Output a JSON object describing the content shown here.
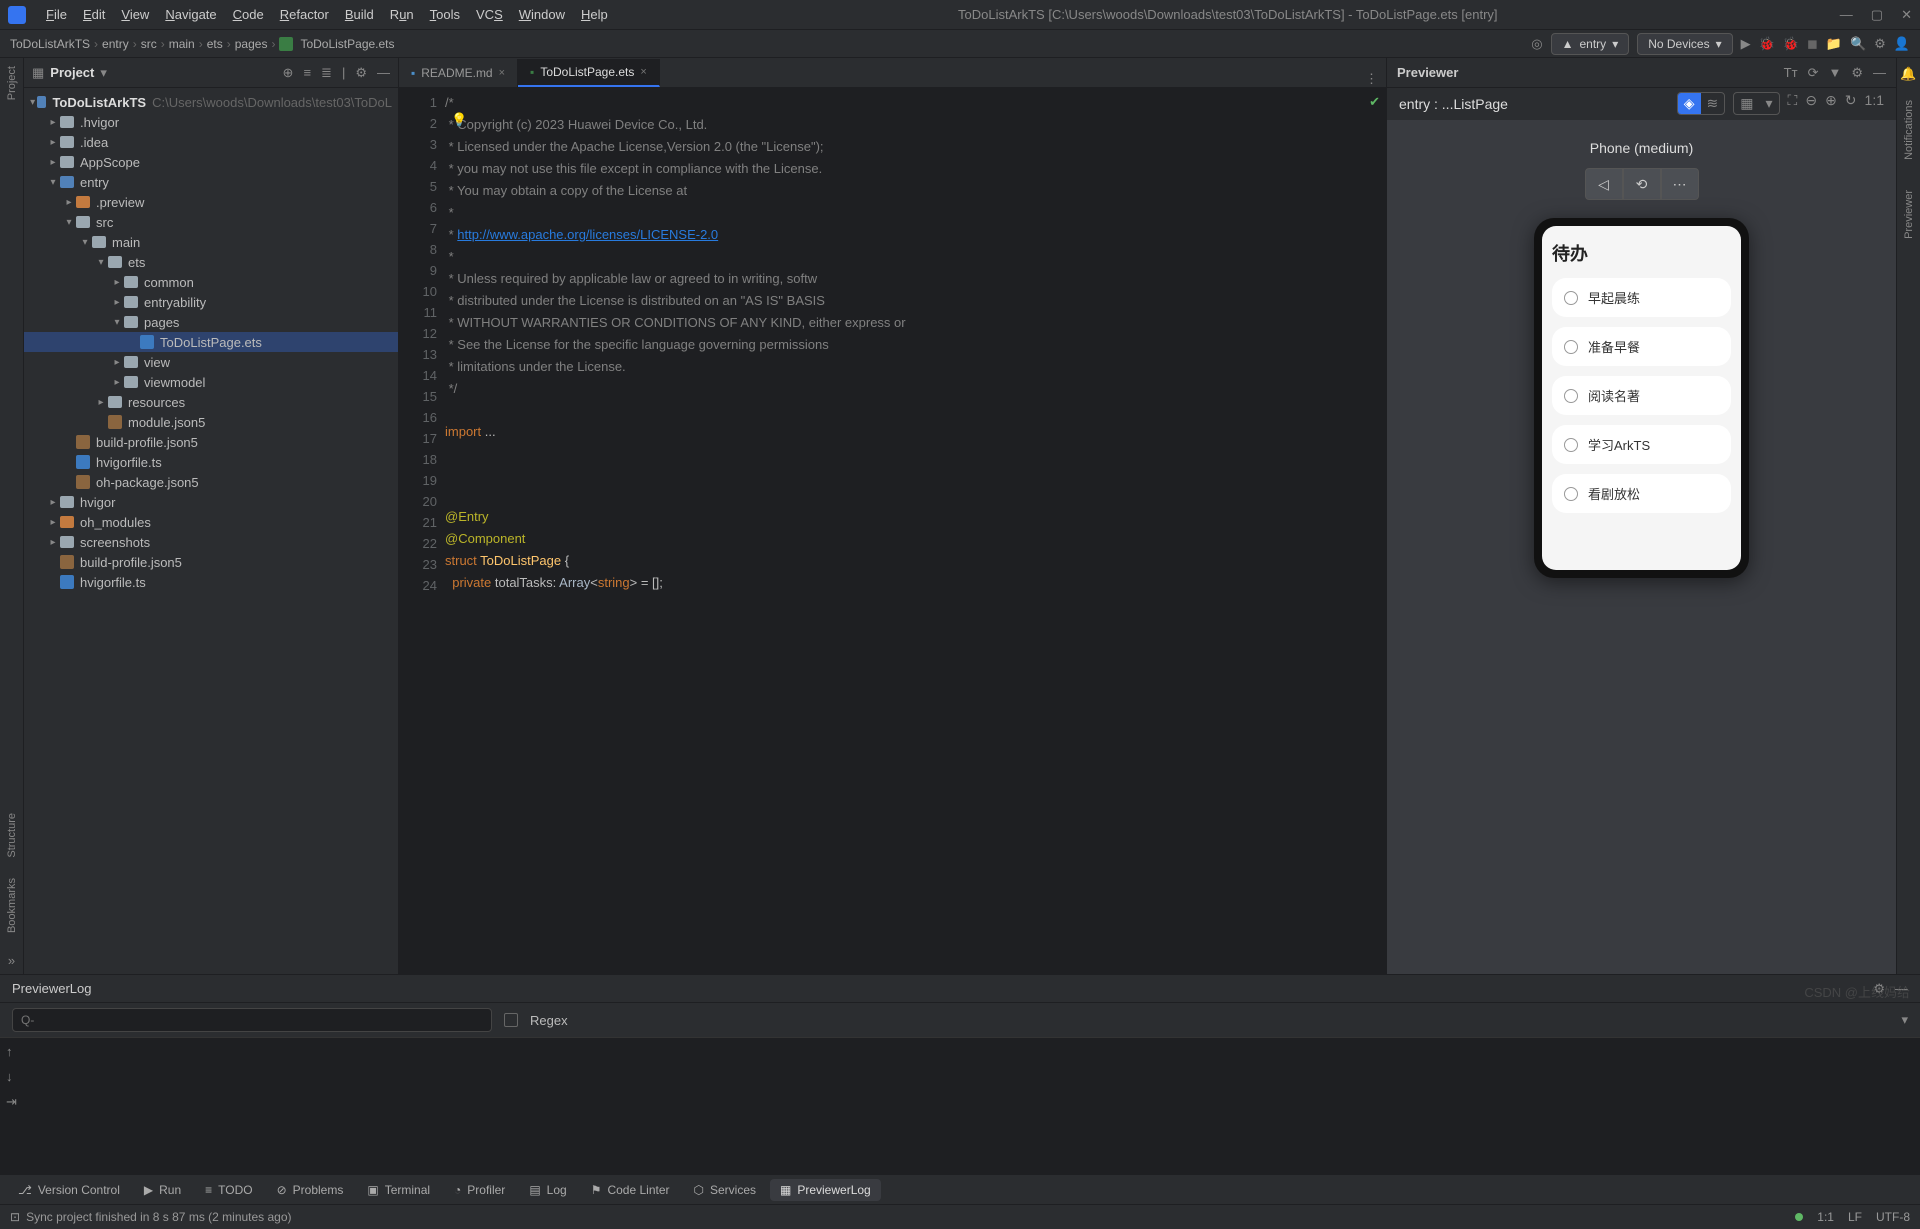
{
  "menubar": {
    "items": [
      "File",
      "Edit",
      "View",
      "Navigate",
      "Code",
      "Refactor",
      "Build",
      "Run",
      "Tools",
      "VCS",
      "Window",
      "Help"
    ],
    "title": "ToDoListArkTS [C:\\Users\\woods\\Downloads\\test03\\ToDoListArkTS] - ToDoListPage.ets [entry]"
  },
  "breadcrumb": [
    "ToDoListArkTS",
    "entry",
    "src",
    "main",
    "ets",
    "pages",
    "ToDoListPage.ets"
  ],
  "toolbar": {
    "config_label": "entry",
    "devices_label": "No Devices"
  },
  "project": {
    "title": "Project",
    "root": {
      "name": "ToDoListArkTS",
      "path": "C:\\Users\\woods\\Downloads\\test03\\ToDoL"
    },
    "tree": [
      {
        "label": ".hvigor",
        "depth": 1,
        "arrow": "▸",
        "folder": true
      },
      {
        "label": ".idea",
        "depth": 1,
        "arrow": "▸",
        "folder": true
      },
      {
        "label": "AppScope",
        "depth": 1,
        "arrow": "▸",
        "folder": true
      },
      {
        "label": "entry",
        "depth": 1,
        "arrow": "▾",
        "folder": true,
        "blue": true
      },
      {
        "label": ".preview",
        "depth": 2,
        "arrow": "▸",
        "folder": true,
        "orange": true
      },
      {
        "label": "src",
        "depth": 2,
        "arrow": "▾",
        "folder": true
      },
      {
        "label": "main",
        "depth": 3,
        "arrow": "▾",
        "folder": true
      },
      {
        "label": "ets",
        "depth": 4,
        "arrow": "▾",
        "folder": true
      },
      {
        "label": "common",
        "depth": 5,
        "arrow": "▸",
        "folder": true
      },
      {
        "label": "entryability",
        "depth": 5,
        "arrow": "▸",
        "folder": true
      },
      {
        "label": "pages",
        "depth": 5,
        "arrow": "▾",
        "folder": true
      },
      {
        "label": "ToDoListPage.ets",
        "depth": 6,
        "file": "ts",
        "selected": true
      },
      {
        "label": "view",
        "depth": 5,
        "arrow": "▸",
        "folder": true
      },
      {
        "label": "viewmodel",
        "depth": 5,
        "arrow": "▸",
        "folder": true
      },
      {
        "label": "resources",
        "depth": 4,
        "arrow": "▸",
        "folder": true
      },
      {
        "label": "module.json5",
        "depth": 4,
        "file": "json"
      },
      {
        "label": "build-profile.json5",
        "depth": 2,
        "file": "json"
      },
      {
        "label": "hvigorfile.ts",
        "depth": 2,
        "file": "ts"
      },
      {
        "label": "oh-package.json5",
        "depth": 2,
        "file": "json"
      },
      {
        "label": "hvigor",
        "depth": 1,
        "arrow": "▸",
        "folder": true
      },
      {
        "label": "oh_modules",
        "depth": 1,
        "arrow": "▸",
        "folder": true,
        "orange": true
      },
      {
        "label": "screenshots",
        "depth": 1,
        "arrow": "▸",
        "folder": true
      },
      {
        "label": "build-profile.json5",
        "depth": 1,
        "file": "json"
      },
      {
        "label": "hvigorfile.ts",
        "depth": 1,
        "file": "ts"
      }
    ]
  },
  "editor": {
    "tabs": [
      {
        "label": "README.md",
        "active": false
      },
      {
        "label": "ToDoListPage.ets",
        "active": true
      }
    ],
    "lines": [
      1,
      2,
      3,
      4,
      5,
      6,
      7,
      8,
      9,
      10,
      11,
      12,
      13,
      14,
      15,
      16,
      17,
      18,
      19,
      20,
      21,
      22,
      23,
      24
    ],
    "code": {
      "l1": "/*",
      "l2": " * Copyright (c) 2023 Huawei Device Co., Ltd.",
      "l3": " * Licensed under the Apache License,Version 2.0 (the \"License\");",
      "l4": " * you may not use this file except in compliance with the License.",
      "l5": " * You may obtain a copy of the License at",
      "l6": " *",
      "l7a": " * ",
      "l7b": "http://www.apache.org/licenses/LICENSE-2.0",
      "l8": " *",
      "l9": " * Unless required by applicable law or agreed to in writing, softw",
      "l10": " * distributed under the License is distributed on an \"AS IS\" BASIS",
      "l11": " * WITHOUT WARRANTIES OR CONDITIONS OF ANY KIND, either express or ",
      "l12": " * See the License for the specific language governing permissions ",
      "l13": " * limitations under the License.",
      "l14": " */",
      "l16_import": "import",
      "l16_rest": " ...",
      "l20": "@Entry",
      "l21": "@Component",
      "l22_struct": "struct",
      "l22_name": " ToDoListPage ",
      "l22_brace": "{",
      "l23_priv": "  private",
      "l23_var": " totalTasks: ",
      "l23_arr": "Array",
      "l23_lt": "<",
      "l23_str": "string",
      "l23_rest": "> = [];"
    }
  },
  "previewer": {
    "title": "Previewer",
    "entry_label": "entry : ...ListPage",
    "device_label": "Phone (medium)",
    "todo_title": "待办",
    "todo_items": [
      "早起晨练",
      "准备早餐",
      "阅读名著",
      "学习ArkTS",
      "看剧放松"
    ]
  },
  "bottom_panel": {
    "title": "PreviewerLog",
    "search_placeholder": "Q-",
    "regex_label": "Regex"
  },
  "bottom_tabs": [
    "Version Control",
    "Run",
    "TODO",
    "Problems",
    "Terminal",
    "Profiler",
    "Log",
    "Code Linter",
    "Services",
    "PreviewerLog"
  ],
  "statusbar": {
    "msg": "Sync project finished in 8 s 87 ms (2 minutes ago)",
    "pos": "1:1",
    "enc": "LF",
    "charset": "UTF-8"
  },
  "left_gutter": [
    "Project",
    "Structure",
    "Bookmarks"
  ],
  "right_gutter": [
    "Notifications",
    "Previewer"
  ],
  "watermark": "CSDN @上线妈给"
}
